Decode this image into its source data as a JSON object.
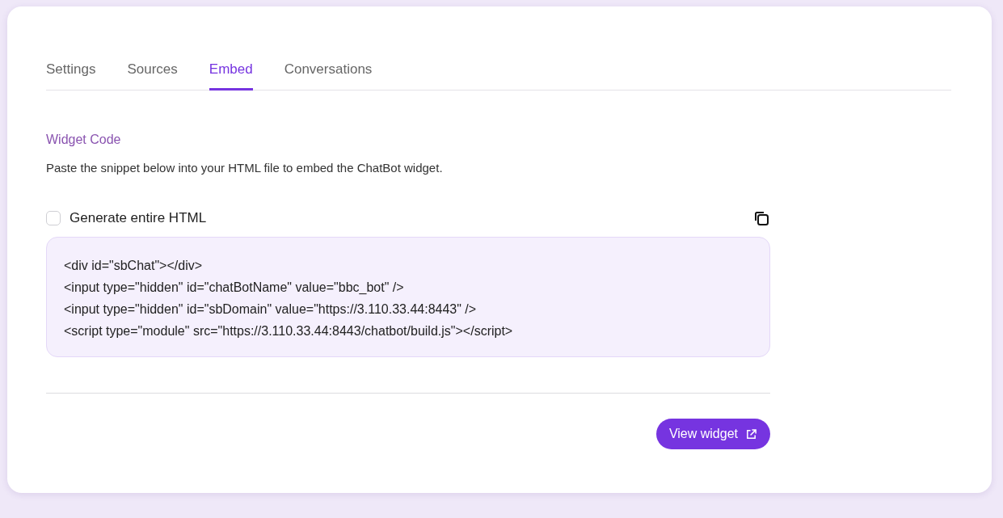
{
  "tabs": [
    {
      "label": "Settings",
      "selected": false
    },
    {
      "label": "Sources",
      "selected": false
    },
    {
      "label": "Embed",
      "selected": true
    },
    {
      "label": "Conversations",
      "selected": false
    }
  ],
  "section": {
    "title": "Widget Code",
    "description": "Paste the snippet below into your HTML file to embed the ChatBot widget."
  },
  "generate_html": {
    "label": "Generate entire HTML",
    "checked": false
  },
  "code_lines": [
    "<div id=\"sbChat\"></div>",
    "<input type=\"hidden\" id=\"chatBotName\" value=\"bbc_bot\" />",
    "<input type=\"hidden\" id=\"sbDomain\" value=\"https://3.110.33.44:8443\" />",
    "<script type=\"module\" src=\"https://3.110.33.44:8443/chatbot/build.js\"></script>"
  ],
  "view_button": {
    "label": "View widget"
  }
}
